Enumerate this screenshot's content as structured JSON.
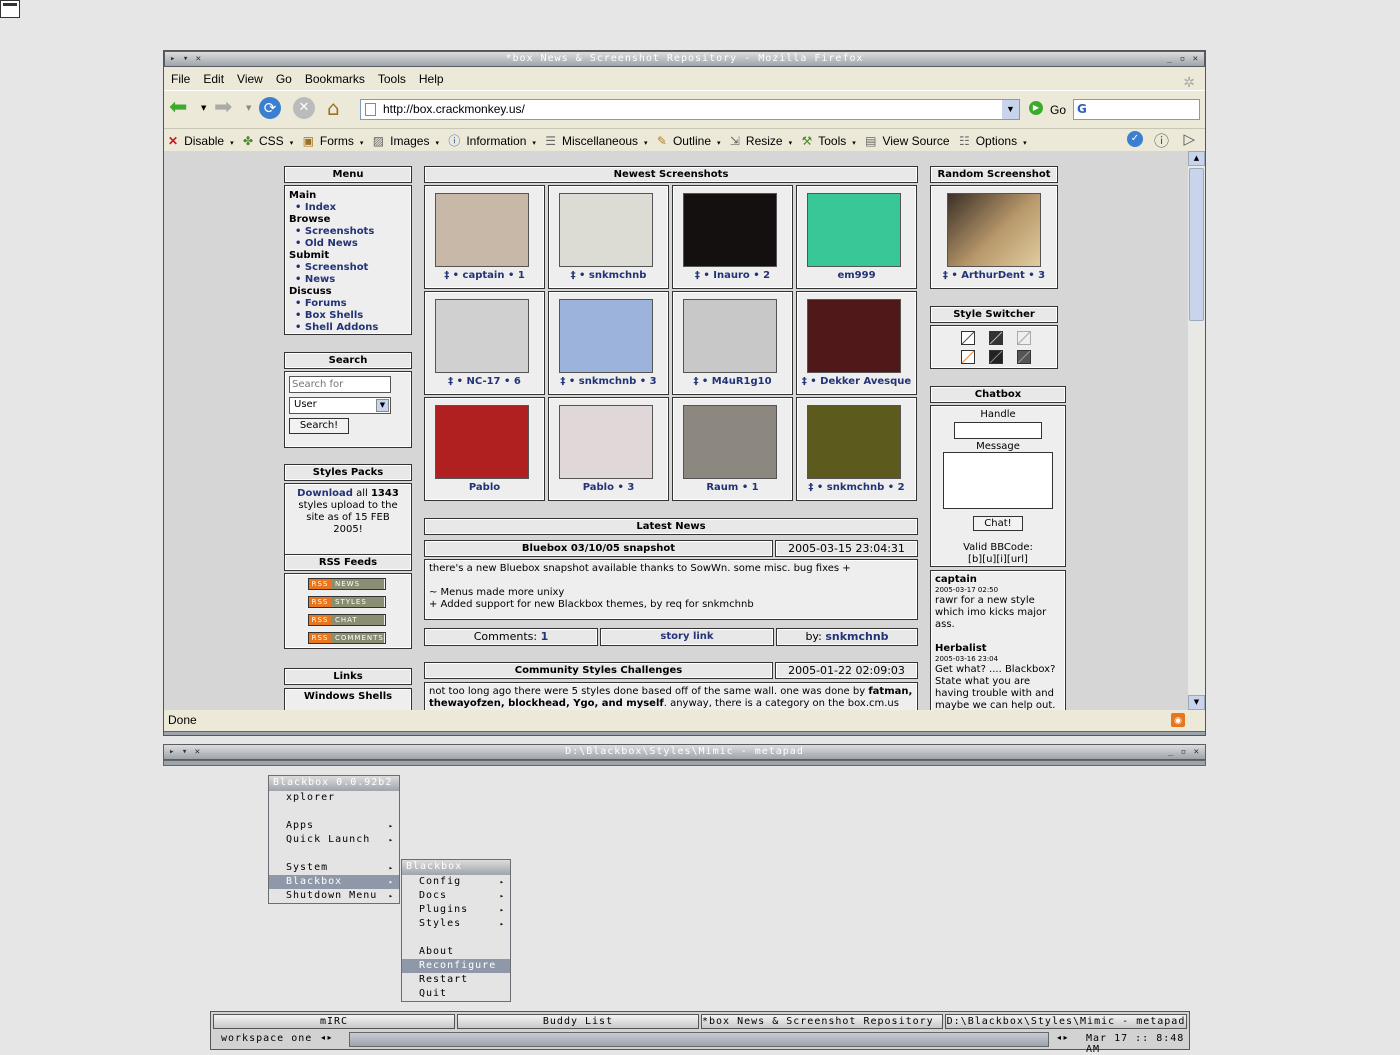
{
  "browser": {
    "title": "*box News & Screenshot Repository - Mozilla Firefox",
    "menus": [
      "File",
      "Edit",
      "View",
      "Go",
      "Bookmarks",
      "Tools",
      "Help"
    ],
    "url": "http://box.crackmonkey.us/",
    "go_label": "Go",
    "webdev_items": [
      "Disable",
      "CSS",
      "Forms",
      "Images",
      "Information",
      "Miscellaneous",
      "Outline",
      "Resize",
      "Tools",
      "View Source",
      "Options"
    ],
    "status": "Done"
  },
  "page": {
    "menu": {
      "title": "Menu",
      "sections": [
        {
          "head": "Main",
          "items": [
            "Index"
          ]
        },
        {
          "head": "Browse",
          "items": [
            "Screenshots",
            "Old News"
          ]
        },
        {
          "head": "Submit",
          "items": [
            "Screenshot",
            "News"
          ]
        },
        {
          "head": "Discuss",
          "items": [
            "Forums",
            "Box Shells",
            "Shell Addons"
          ]
        }
      ]
    },
    "search": {
      "title": "Search",
      "placeholder": "Search for",
      "select": "User",
      "button": "Search!"
    },
    "styles_packs": {
      "title": "Styles Packs",
      "link": "Download",
      "text1": "all",
      "count": "1343",
      "text2": "styles upload to the site as of 15 FEB 2005!"
    },
    "rss": {
      "title": "RSS Feeds",
      "feeds": [
        "NEWS",
        "STYLES",
        "CHAT",
        "COMMENTS"
      ]
    },
    "links": {
      "title": "Links",
      "sub": "Windows Shells"
    },
    "newest": {
      "title": "Newest Screenshots",
      "thumbs": [
        {
          "caption": "‡ • captain • 1",
          "color": "#c8b8a8"
        },
        {
          "caption": "‡ • snkmchnb",
          "color": "#dcdcd4"
        },
        {
          "caption": "‡ • Inauro • 2",
          "color": "#151010"
        },
        {
          "caption": "em999",
          "color": "#38c898"
        },
        {
          "caption": "‡ • NC-17 • 6",
          "color": "#d0d0d0"
        },
        {
          "caption": "‡ • snkmchnb • 3",
          "color": "#9cb4dc"
        },
        {
          "caption": "‡ • M4uR1g10",
          "color": "#c8c8c8"
        },
        {
          "caption": "‡ • Dekker Avesque",
          "color": "#501818"
        },
        {
          "caption": "Pablo",
          "color": "#b02020"
        },
        {
          "caption": "Pablo • 3",
          "color": "#e0d8d8"
        },
        {
          "caption": "Raum • 1",
          "color": "#8c8880"
        },
        {
          "caption": "‡ • snkmchnb • 2",
          "color": "#5c5a1c"
        }
      ]
    },
    "latest_news_title": "Latest News",
    "news": [
      {
        "title": "Bluebox 03/10/05 snapshot",
        "date": "2005-03-15 23:04:31",
        "body": [
          "there's a new Bluebox snapshot available thanks to SowWn. some misc. bug fixes +",
          "",
          "~ Menus made more unixy",
          "+ Added support for new Blackbox themes, by req for snkmchnb"
        ],
        "comments_label": "Comments:",
        "comments_count": "1",
        "story_link": "story link",
        "by_label": "by:",
        "by": "snkmchnb"
      },
      {
        "title": "Community Styles Challenges",
        "date": "2005-01-22 02:09:03",
        "body_start": "not too long ago there were 5 styles done based off of the same wall. one was done by",
        "body_bold": "fatman, thewayofzen, blockhead, Ygo, and myself",
        "body_end": ". anyway, there is a category on the box.cm.us forums,"
      }
    ],
    "random": {
      "title": "Random Screenshot",
      "caption": "‡ • ArthurDent • 3"
    },
    "style_switcher_title": "Style Switcher",
    "chatbox": {
      "title": "Chatbox",
      "handle_label": "Handle",
      "message_label": "Message",
      "button": "Chat!",
      "bbcode_label": "Valid BBCode:",
      "bbcode": "[b][u][i][url]",
      "messages": [
        {
          "user": "captain",
          "time": "2005-03-17 02:50",
          "text": "rawr for a new style which imo kicks major ass."
        },
        {
          "user": "Herbalist",
          "time": "2005-03-16 23:04",
          "text": "Get what? .... Blackbox? State what you are having trouble with and maybe we can help out."
        }
      ]
    }
  },
  "metapad": {
    "title": "D:\\Blackbox\\Styles\\Mimic - metapad"
  },
  "root_menu": {
    "title": "Blackbox 0.0.92b2",
    "items": [
      {
        "label": "xplorer",
        "arrow": false
      },
      {
        "label": "",
        "arrow": false
      },
      {
        "label": "Apps",
        "arrow": true
      },
      {
        "label": "Quick Launch",
        "arrow": true
      },
      {
        "label": "",
        "arrow": false
      },
      {
        "label": "System",
        "arrow": true
      },
      {
        "label": "Blackbox",
        "arrow": true,
        "selected": true
      },
      {
        "label": "Shutdown Menu",
        "arrow": true
      }
    ]
  },
  "bb_submenu": {
    "title": "Blackbox",
    "items": [
      {
        "label": "Config",
        "arrow": true
      },
      {
        "label": "Docs",
        "arrow": true
      },
      {
        "label": "Plugins",
        "arrow": true
      },
      {
        "label": "Styles",
        "arrow": true
      },
      {
        "label": "",
        "arrow": false
      },
      {
        "label": "About",
        "arrow": false
      },
      {
        "label": "Reconfigure",
        "arrow": false,
        "selected": true
      },
      {
        "label": "Restart",
        "arrow": false
      },
      {
        "label": "Quit",
        "arrow": false
      }
    ]
  },
  "taskbar": {
    "tasks": [
      "mIRC",
      "Buddy List",
      "*box News & Screenshot Repository -...",
      "D:\\Blackbox\\Styles\\Mimic - metapad"
    ],
    "workspace": "workspace one",
    "clock": "Mar 17 :: 8:48 AM"
  }
}
